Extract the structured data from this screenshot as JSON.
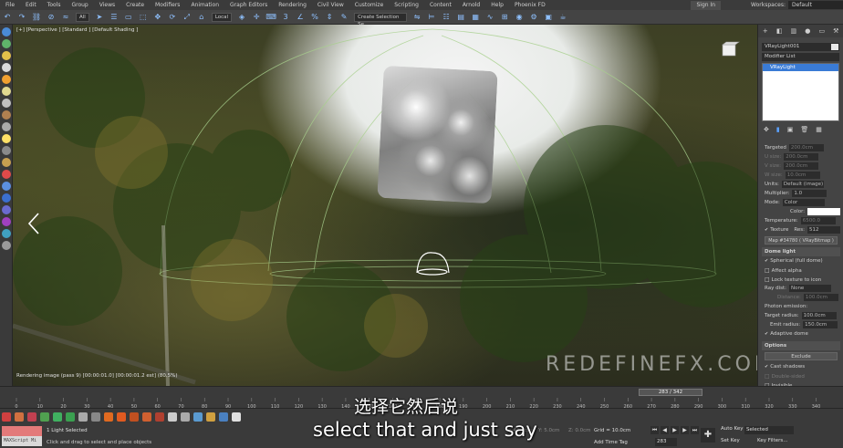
{
  "menu": {
    "items": [
      "File",
      "Edit",
      "Tools",
      "Group",
      "Views",
      "Create",
      "Modifiers",
      "Animation",
      "Graph Editors",
      "Rendering",
      "Civil View",
      "Customize",
      "Scripting",
      "Content",
      "Arnold",
      "Help",
      "Phoenix FD"
    ],
    "sign_in": "Sign In",
    "workspaces_label": "Workspaces:",
    "workspaces_value": "Default"
  },
  "toolbar": {
    "filter_value": "All",
    "coord_value": "Local",
    "selection_set_placeholder": "Create Selection Se"
  },
  "viewport": {
    "label": "[+] [Perspective ] [Standard ] [Default Shading ]",
    "render_status": "Rendering image (pass 9) [00:00:01.0] [00:00:01.2 est]    (80.5%)",
    "watermark": "REDEFINEFX.COM"
  },
  "command_panel": {
    "object_name": "VRayLight001",
    "modifier_list": "Modifier List",
    "stack_item": "VRayLight",
    "params": {
      "targeted": "Targeted",
      "targeted_val": "200.0cm",
      "u_size": "U size:",
      "u_size_val": "200.0cm",
      "v_size": "V size:",
      "v_size_val": "200.0cm",
      "w_size": "W size:",
      "w_size_val": "10.0cm",
      "units_label": "Units:",
      "units_value": "Default (image)",
      "multiplier_label": "Multiplier:",
      "multiplier_value": "1.0",
      "mode_label": "Mode:",
      "mode_value": "Color",
      "color_label": "Color:",
      "temperature_label": "Temperature:",
      "temperature_value": "6500.0",
      "texture_label": "Texture",
      "res_label": "Res:",
      "res_value": "512",
      "map_value": "Map #34780  ( VRayBitmap )"
    },
    "dome": {
      "header": "Dome light",
      "spherical": "Spherical (full dome)",
      "affect_alpha": "Affect alpha",
      "lock_texture": "Lock texture to icon",
      "ray_dist_label": "Ray dist:",
      "ray_dist_value": "None",
      "distance_label": "Distance:",
      "distance_value": "100.0cm",
      "photon_label": "Photon emission:",
      "target_radius_label": "Target radius:",
      "target_radius_value": "100.0cm",
      "emit_radius_label": "Emit radius:",
      "emit_radius_value": "150.0cm",
      "adaptive": "Adaptive dome"
    },
    "options": {
      "header": "Options",
      "exclude": "Exclude",
      "cast_shadows": "Cast shadows",
      "double_sided": "Double-sided",
      "invisible": "Invisible"
    }
  },
  "timeline": {
    "frame_display": "283 / 342",
    "ticks": [
      "0",
      "10",
      "20",
      "30",
      "40",
      "50",
      "60",
      "70",
      "80",
      "90",
      "100",
      "110",
      "120",
      "130",
      "140",
      "150",
      "160",
      "170",
      "180",
      "190",
      "200",
      "210",
      "220",
      "230",
      "240",
      "250",
      "260",
      "270",
      "280",
      "290",
      "300",
      "310",
      "320",
      "330",
      "340"
    ]
  },
  "status": {
    "maxscript": "MAXScript Mi",
    "selection": "1 Light Selected",
    "hint": "Click and drag to select and place objects",
    "x": "X: 44.4cm",
    "y": "Y: 5.0cm",
    "z": "Z: 0.0cm",
    "grid": "Grid = 10.0cm",
    "add_time_tag": "Add Time Tag",
    "frame": "283",
    "auto_key": "Auto Key",
    "set_key": "Set Key",
    "selected": "Selected",
    "key_filters": "Key Filters..."
  },
  "subtitles": {
    "chinese": "选择它然后说",
    "english": "select that and just say"
  },
  "colors": {
    "accent": "#3a7bd5",
    "dome_gizmo": "#a8d08d"
  }
}
